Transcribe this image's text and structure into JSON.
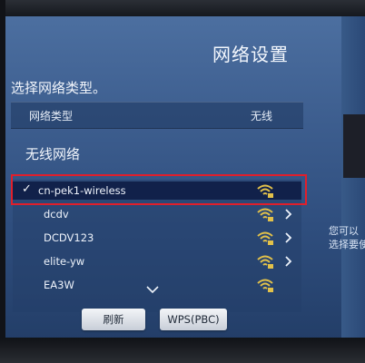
{
  "screen": {
    "title": "网络设置",
    "subtitle": "选择网络类型。",
    "network_type": {
      "label": "网络类型",
      "value": "无线"
    },
    "wireless_section": "无线网络",
    "networks": [
      {
        "name": "cn-pek1-wireless",
        "selected": true,
        "signal_icon": "wifi-lock-icon",
        "has_chevron": false
      },
      {
        "name": "dcdv",
        "selected": false,
        "signal_icon": "wifi-lock-icon",
        "has_chevron": true
      },
      {
        "name": "DCDV123",
        "selected": false,
        "signal_icon": "wifi-lock-icon",
        "has_chevron": true
      },
      {
        "name": "elite-yw",
        "selected": false,
        "signal_icon": "wifi-lock-icon",
        "has_chevron": true
      },
      {
        "name": "EA3W",
        "selected": false,
        "signal_icon": "wifi-lock-icon",
        "has_chevron": false
      }
    ],
    "more_indicator": "chevron-down-icon",
    "buttons": {
      "refresh": "刷新",
      "wps": "WPS(PBC)"
    },
    "side_hint": {
      "line1": "您可以",
      "line2": "选择要使"
    }
  },
  "colors": {
    "accent_highlight": "#e11f2b",
    "selected_row": "#11214a",
    "wifi_gold": "#e2c14a"
  }
}
